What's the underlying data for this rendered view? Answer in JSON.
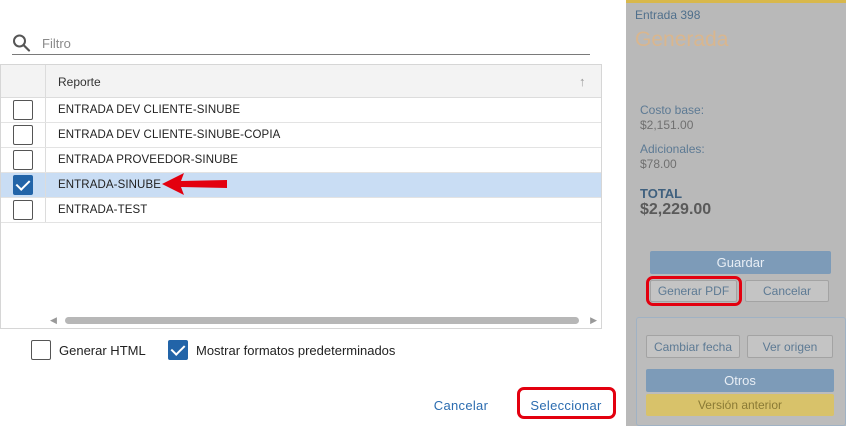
{
  "background_panel": {
    "entry_label": "Entrada 398",
    "status": "Generada",
    "base_cost_label": "Costo base:",
    "base_cost_value": "$2,151.00",
    "extras_label": "Adicionales:",
    "extras_value": "$78.00",
    "total_label": "TOTAL",
    "total_value": "$2,229.00",
    "save_button": "Guardar",
    "generate_pdf_button": "Generar PDF",
    "cancel_button": "Cancelar",
    "change_date_button": "Cambiar fecha",
    "view_origin_button": "Ver origen",
    "others_button": "Otros",
    "previous_version_button": "Versión anterior"
  },
  "dialog": {
    "filter": {
      "placeholder": "Filtro",
      "value": ""
    },
    "grid": {
      "column_header": "Reporte",
      "rows": [
        {
          "label": "ENTRADA DEV CLIENTE-SINUBE",
          "checked": false
        },
        {
          "label": "ENTRADA DEV CLIENTE-SINUBE-COPIA",
          "checked": false
        },
        {
          "label": "ENTRADA PROVEEDOR-SINUBE",
          "checked": false
        },
        {
          "label": "ENTRADA-SINUBE",
          "checked": true
        },
        {
          "label": "ENTRADA-TEST",
          "checked": false
        }
      ]
    },
    "options": {
      "generate_html": {
        "label": "Generar HTML",
        "checked": false
      },
      "show_default_formats": {
        "label": "Mostrar formatos predeterminados",
        "checked": true
      }
    },
    "footer": {
      "cancel": "Cancelar",
      "select": "Seleccionar"
    }
  },
  "colors": {
    "accent": "#2264a8",
    "selected_row": "#c9ddf4",
    "annotation_red": "#e3000f"
  }
}
